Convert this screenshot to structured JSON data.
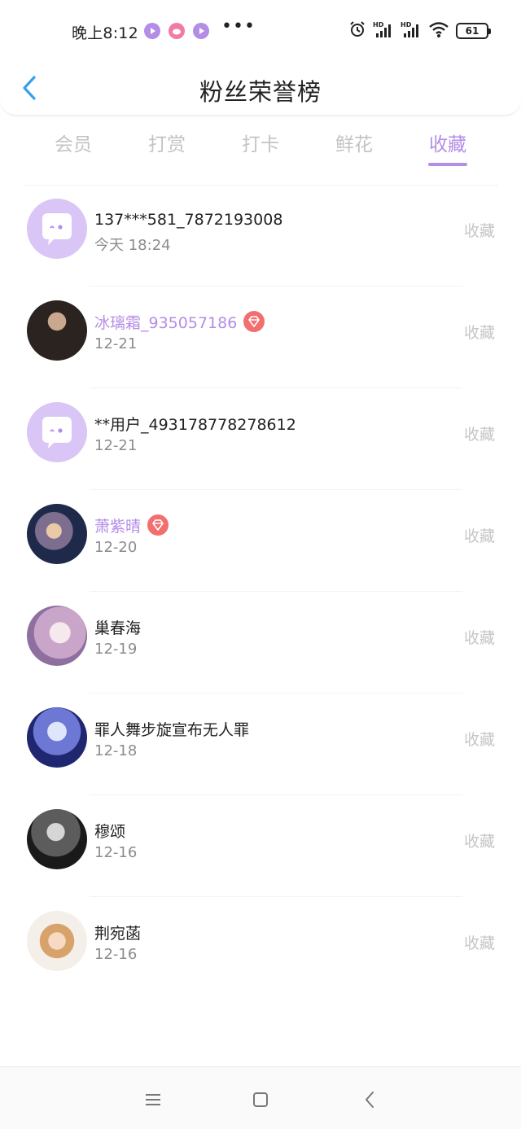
{
  "status_bar": {
    "time": "晚上8:12",
    "dots": "•••",
    "battery": "61",
    "icons": [
      "video-app-icon",
      "weibo-app-icon",
      "video-app-icon",
      "alarm-icon",
      "hd-signal-icon",
      "hd-signal-icon",
      "wifi-icon",
      "battery-icon"
    ]
  },
  "header": {
    "title": "粉丝荣誉榜",
    "back_icon": "chevron-left-icon"
  },
  "tabs": [
    {
      "label": "会员",
      "active": false
    },
    {
      "label": "打赏",
      "active": false
    },
    {
      "label": "打卡",
      "active": false
    },
    {
      "label": "鲜花",
      "active": false
    },
    {
      "label": "收藏",
      "active": true
    }
  ],
  "fans": [
    {
      "name": "137***581_7872193008",
      "date": "今天 18:24",
      "action": "收藏",
      "vip": false,
      "avatar": "default-avatar"
    },
    {
      "name": "冰璃霜_935057186",
      "date": "12-21",
      "action": "收藏",
      "vip": true,
      "avatar": "user-photo"
    },
    {
      "name": "**用户_493178778278612",
      "date": "12-21",
      "action": "收藏",
      "vip": false,
      "avatar": "default-avatar"
    },
    {
      "name": "萧紫晴",
      "date": "12-20",
      "action": "收藏",
      "vip": true,
      "avatar": "user-photo"
    },
    {
      "name": "巢春海",
      "date": "12-19",
      "action": "收藏",
      "vip": false,
      "avatar": "user-photo"
    },
    {
      "name": "罪人舞步旋宣布无人罪",
      "date": "12-18",
      "action": "收藏",
      "vip": false,
      "avatar": "user-photo"
    },
    {
      "name": "穆颂",
      "date": "12-16",
      "action": "收藏",
      "vip": false,
      "avatar": "user-photo"
    },
    {
      "name": "荆宛菡",
      "date": "12-16",
      "action": "收藏",
      "vip": false,
      "avatar": "user-photo"
    }
  ],
  "nav_bar": {
    "icons": [
      "menu-icon",
      "home-square-icon",
      "back-triangle-icon"
    ]
  },
  "colors": {
    "accent": "#b48de6",
    "vip_badge": "#f26f6f",
    "muted": "#c3c3c3",
    "back_arrow": "#3aa0e8"
  }
}
